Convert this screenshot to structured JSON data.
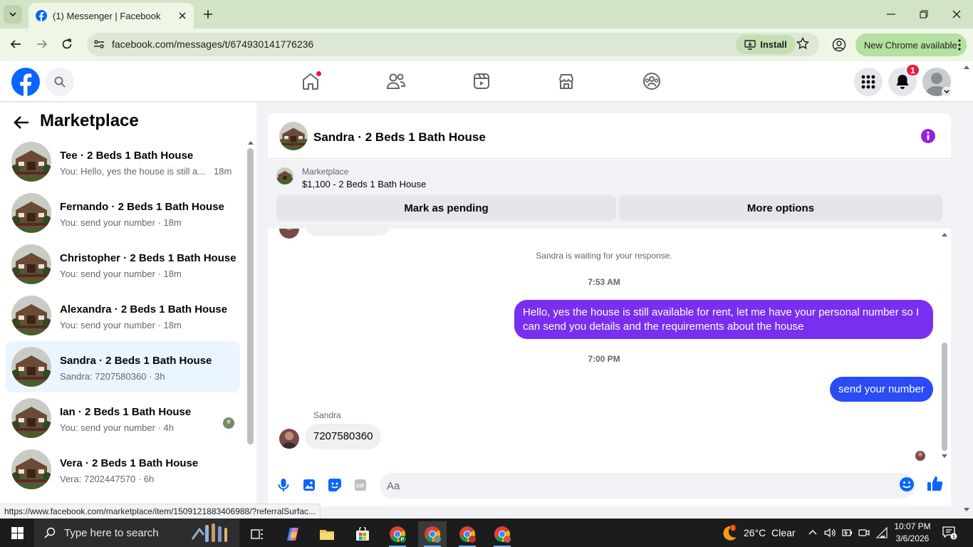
{
  "browser": {
    "tab_title": "(1) Messenger | Facebook",
    "url": "facebook.com/messages/t/674930141776236",
    "install_label": "Install",
    "new_chrome_label": "New Chrome available",
    "status_url": "https://www.facebook.com/marketplace/item/1509121883406988/?referralSurfac..."
  },
  "fb_header": {
    "notification_count": "1",
    "nav_items": [
      "home-icon",
      "friends-icon",
      "video-icon",
      "marketplace-icon",
      "groups-icon"
    ]
  },
  "left_panel": {
    "title": "Marketplace",
    "conversations": [
      {
        "name": "Tee · 2 Beds 1 Bath House",
        "preview": "You: Hello, yes the house is still a...",
        "time": "18m",
        "active": false
      },
      {
        "name": "Fernando · 2 Beds 1 Bath House",
        "preview": "You: send your number · 18m",
        "active": false
      },
      {
        "name": "Christopher · 2 Beds 1 Bath House",
        "preview": "You: send your number · 18m",
        "active": false
      },
      {
        "name": "Alexandra · 2 Beds 1 Bath House",
        "preview": "You: send your number · 18m",
        "active": false
      },
      {
        "name": "Sandra · 2 Beds 1 Bath House",
        "preview": "Sandra: 7207580360 · 3h",
        "active": true
      },
      {
        "name": "Ian · 2 Beds 1 Bath House",
        "preview": "You: send your number · 4h",
        "active": false
      },
      {
        "name": "Vera · 2 Beds 1 Bath House",
        "preview": "Vera: 7202447570 · 6h",
        "active": false
      }
    ]
  },
  "chat": {
    "title": "Sandra · 2 Beds 1 Bath House",
    "marketplace_label": "Marketplace",
    "item": "$1,100 - 2 Beds 1 Bath House",
    "mark_pending_label": "Mark as pending",
    "more_options_label": "More options",
    "waiting_note": "Sandra is waiting for your response.",
    "time_1": "7:53 AM",
    "outgoing_1": "Hello, yes the house is still available for rent, let me have your personal number so I can send you details and the requirements about the house",
    "time_2": "7:00 PM",
    "outgoing_2": "send your number",
    "sender_name": "Sandra",
    "incoming_1": "7207580360",
    "input_placeholder": "Aa",
    "outgoing_bubble_color": "#7a2ff0",
    "outgoing_bubble_color_2": "#2a4bf5",
    "accent": "#0866ff"
  },
  "taskbar": {
    "search_placeholder": "Type here to search",
    "weather": "26°C  Clear",
    "time": "10:07 PM",
    "date": "3/6/2026",
    "notification_count": "1"
  }
}
